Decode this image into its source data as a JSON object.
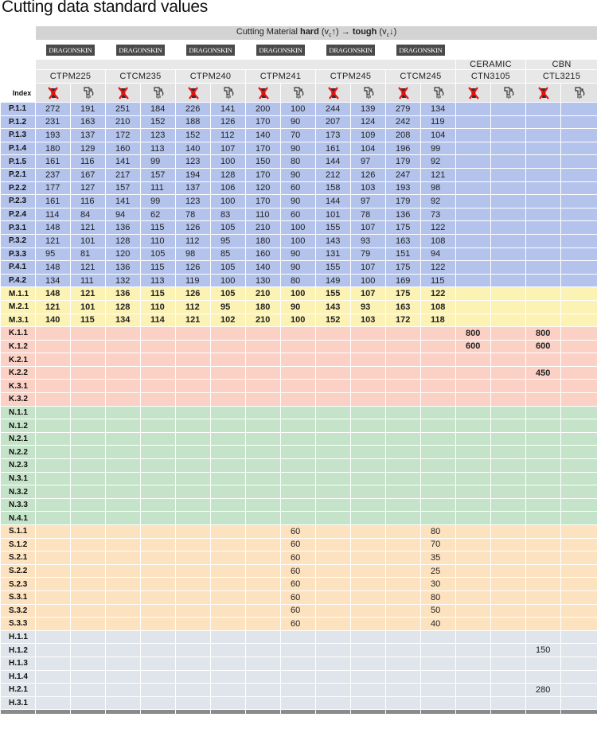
{
  "page_title": "Cutting data standard values",
  "band": {
    "pre": "Cutting Material ",
    "hard": "hard",
    "mid1": " (v",
    "sub1": "c",
    "arrow1": "↑) → ",
    "tough": "tough",
    "mid2": " (v",
    "sub2": "c",
    "arrow2": "↓)"
  },
  "logo_text": "DRAGONSKIN",
  "index_label": "Index",
  "top_grades": {
    "ceramic": "CERAMIC",
    "cbn": "CBN"
  },
  "grades": [
    "CTPM225",
    "CTCM235",
    "CTPM240",
    "CTPM241",
    "CTPM245",
    "CTCM245",
    "CTN3105",
    "CTL3215"
  ],
  "icons": {
    "dry": "dry-cutting-icon",
    "wet": "coolant-icon"
  },
  "colors": {
    "P": "#b4c3ec",
    "M": "#fbf2b4",
    "K": "#fbd1c6",
    "N": "#c5e3c9",
    "S": "#fde2bf",
    "H": "#dfe5ea"
  },
  "rows": [
    {
      "idx": "P.1.1",
      "g": "P",
      "bold": false,
      "v": [
        "272",
        "191",
        "251",
        "184",
        "226",
        "141",
        "200",
        "100",
        "244",
        "139",
        "279",
        "134",
        "",
        "",
        "",
        ""
      ]
    },
    {
      "idx": "P.1.2",
      "g": "P",
      "bold": false,
      "v": [
        "231",
        "163",
        "210",
        "152",
        "188",
        "126",
        "170",
        "90",
        "207",
        "124",
        "242",
        "119",
        "",
        "",
        "",
        ""
      ]
    },
    {
      "idx": "P.1.3",
      "g": "P",
      "bold": false,
      "v": [
        "193",
        "137",
        "172",
        "123",
        "152",
        "112",
        "140",
        "70",
        "173",
        "109",
        "208",
        "104",
        "",
        "",
        "",
        ""
      ]
    },
    {
      "idx": "P.1.4",
      "g": "P",
      "bold": false,
      "v": [
        "180",
        "129",
        "160",
        "113",
        "140",
        "107",
        "170",
        "90",
        "161",
        "104",
        "196",
        "99",
        "",
        "",
        "",
        ""
      ]
    },
    {
      "idx": "P.1.5",
      "g": "P",
      "bold": false,
      "v": [
        "161",
        "116",
        "141",
        "99",
        "123",
        "100",
        "150",
        "80",
        "144",
        "97",
        "179",
        "92",
        "",
        "",
        "",
        ""
      ]
    },
    {
      "idx": "P.2.1",
      "g": "P",
      "bold": false,
      "v": [
        "237",
        "167",
        "217",
        "157",
        "194",
        "128",
        "170",
        "90",
        "212",
        "126",
        "247",
        "121",
        "",
        "",
        "",
        ""
      ]
    },
    {
      "idx": "P.2.2",
      "g": "P",
      "bold": false,
      "v": [
        "177",
        "127",
        "157",
        "111",
        "137",
        "106",
        "120",
        "60",
        "158",
        "103",
        "193",
        "98",
        "",
        "",
        "",
        ""
      ]
    },
    {
      "idx": "P.2.3",
      "g": "P",
      "bold": false,
      "v": [
        "161",
        "116",
        "141",
        "99",
        "123",
        "100",
        "170",
        "90",
        "144",
        "97",
        "179",
        "92",
        "",
        "",
        "",
        ""
      ]
    },
    {
      "idx": "P.2.4",
      "g": "P",
      "bold": false,
      "v": [
        "114",
        "84",
        "94",
        "62",
        "78",
        "83",
        "110",
        "60",
        "101",
        "78",
        "136",
        "73",
        "",
        "",
        "",
        ""
      ]
    },
    {
      "idx": "P.3.1",
      "g": "P",
      "bold": false,
      "v": [
        "148",
        "121",
        "136",
        "115",
        "126",
        "105",
        "210",
        "100",
        "155",
        "107",
        "175",
        "122",
        "",
        "",
        "",
        ""
      ]
    },
    {
      "idx": "P.3.2",
      "g": "P",
      "bold": false,
      "v": [
        "121",
        "101",
        "128",
        "110",
        "112",
        "95",
        "180",
        "100",
        "143",
        "93",
        "163",
        "108",
        "",
        "",
        "",
        ""
      ]
    },
    {
      "idx": "P.3.3",
      "g": "P",
      "bold": false,
      "v": [
        "95",
        "81",
        "120",
        "105",
        "98",
        "85",
        "160",
        "90",
        "131",
        "79",
        "151",
        "94",
        "",
        "",
        "",
        ""
      ]
    },
    {
      "idx": "P.4.1",
      "g": "P",
      "bold": false,
      "v": [
        "148",
        "121",
        "136",
        "115",
        "126",
        "105",
        "140",
        "90",
        "155",
        "107",
        "175",
        "122",
        "",
        "",
        "",
        ""
      ]
    },
    {
      "idx": "P.4.2",
      "g": "P",
      "bold": false,
      "v": [
        "134",
        "111",
        "132",
        "113",
        "119",
        "100",
        "130",
        "80",
        "149",
        "100",
        "169",
        "115",
        "",
        "",
        "",
        ""
      ]
    },
    {
      "idx": "M.1.1",
      "g": "M",
      "bold": true,
      "v": [
        "148",
        "121",
        "136",
        "115",
        "126",
        "105",
        "210",
        "100",
        "155",
        "107",
        "175",
        "122",
        "",
        "",
        "",
        ""
      ]
    },
    {
      "idx": "M.2.1",
      "g": "M",
      "bold": true,
      "v": [
        "121",
        "101",
        "128",
        "110",
        "112",
        "95",
        "180",
        "90",
        "143",
        "93",
        "163",
        "108",
        "",
        "",
        "",
        ""
      ]
    },
    {
      "idx": "M.3.1",
      "g": "M",
      "bold": true,
      "v": [
        "140",
        "115",
        "134",
        "114",
        "121",
        "102",
        "210",
        "100",
        "152",
        "103",
        "172",
        "118",
        "",
        "",
        "",
        ""
      ]
    },
    {
      "idx": "K.1.1",
      "g": "K",
      "bold": true,
      "v": [
        "",
        "",
        "",
        "",
        "",
        "",
        "",
        "",
        "",
        "",
        "",
        "",
        "800",
        "",
        "800",
        ""
      ]
    },
    {
      "idx": "K.1.2",
      "g": "K",
      "bold": true,
      "v": [
        "",
        "",
        "",
        "",
        "",
        "",
        "",
        "",
        "",
        "",
        "",
        "",
        "600",
        "",
        "600",
        ""
      ]
    },
    {
      "idx": "K.2.1",
      "g": "K",
      "bold": true,
      "v": [
        "",
        "",
        "",
        "",
        "",
        "",
        "",
        "",
        "",
        "",
        "",
        "",
        "",
        "",
        "",
        ""
      ]
    },
    {
      "idx": "K.2.2",
      "g": "K",
      "bold": true,
      "v": [
        "",
        "",
        "",
        "",
        "",
        "",
        "",
        "",
        "",
        "",
        "",
        "",
        "",
        "",
        "450",
        ""
      ]
    },
    {
      "idx": "K.3.1",
      "g": "K",
      "bold": true,
      "v": [
        "",
        "",
        "",
        "",
        "",
        "",
        "",
        "",
        "",
        "",
        "",
        "",
        "",
        "",
        "",
        ""
      ]
    },
    {
      "idx": "K.3.2",
      "g": "K",
      "bold": true,
      "v": [
        "",
        "",
        "",
        "",
        "",
        "",
        "",
        "",
        "",
        "",
        "",
        "",
        "",
        "",
        "",
        ""
      ]
    },
    {
      "idx": "N.1.1",
      "g": "N",
      "bold": false,
      "v": [
        "",
        "",
        "",
        "",
        "",
        "",
        "",
        "",
        "",
        "",
        "",
        "",
        "",
        "",
        "",
        ""
      ]
    },
    {
      "idx": "N.1.2",
      "g": "N",
      "bold": false,
      "v": [
        "",
        "",
        "",
        "",
        "",
        "",
        "",
        "",
        "",
        "",
        "",
        "",
        "",
        "",
        "",
        ""
      ]
    },
    {
      "idx": "N.2.1",
      "g": "N",
      "bold": false,
      "v": [
        "",
        "",
        "",
        "",
        "",
        "",
        "",
        "",
        "",
        "",
        "",
        "",
        "",
        "",
        "",
        ""
      ]
    },
    {
      "idx": "N.2.2",
      "g": "N",
      "bold": false,
      "v": [
        "",
        "",
        "",
        "",
        "",
        "",
        "",
        "",
        "",
        "",
        "",
        "",
        "",
        "",
        "",
        ""
      ]
    },
    {
      "idx": "N.2.3",
      "g": "N",
      "bold": false,
      "v": [
        "",
        "",
        "",
        "",
        "",
        "",
        "",
        "",
        "",
        "",
        "",
        "",
        "",
        "",
        "",
        ""
      ]
    },
    {
      "idx": "N.3.1",
      "g": "N",
      "bold": false,
      "v": [
        "",
        "",
        "",
        "",
        "",
        "",
        "",
        "",
        "",
        "",
        "",
        "",
        "",
        "",
        "",
        ""
      ]
    },
    {
      "idx": "N.3.2",
      "g": "N",
      "bold": false,
      "v": [
        "",
        "",
        "",
        "",
        "",
        "",
        "",
        "",
        "",
        "",
        "",
        "",
        "",
        "",
        "",
        ""
      ]
    },
    {
      "idx": "N.3.3",
      "g": "N",
      "bold": false,
      "v": [
        "",
        "",
        "",
        "",
        "",
        "",
        "",
        "",
        "",
        "",
        "",
        "",
        "",
        "",
        "",
        ""
      ]
    },
    {
      "idx": "N.4.1",
      "g": "N",
      "bold": false,
      "v": [
        "",
        "",
        "",
        "",
        "",
        "",
        "",
        "",
        "",
        "",
        "",
        "",
        "",
        "",
        "",
        ""
      ]
    },
    {
      "idx": "S.1.1",
      "g": "S",
      "bold": false,
      "v": [
        "",
        "",
        "",
        "",
        "",
        "",
        "",
        "60",
        "",
        "",
        "",
        "80",
        "",
        "",
        "",
        ""
      ]
    },
    {
      "idx": "S.1.2",
      "g": "S",
      "bold": false,
      "v": [
        "",
        "",
        "",
        "",
        "",
        "",
        "",
        "60",
        "",
        "",
        "",
        "70",
        "",
        "",
        "",
        ""
      ]
    },
    {
      "idx": "S.2.1",
      "g": "S",
      "bold": false,
      "v": [
        "",
        "",
        "",
        "",
        "",
        "",
        "",
        "60",
        "",
        "",
        "",
        "35",
        "",
        "",
        "",
        ""
      ]
    },
    {
      "idx": "S.2.2",
      "g": "S",
      "bold": false,
      "v": [
        "",
        "",
        "",
        "",
        "",
        "",
        "",
        "60",
        "",
        "",
        "",
        "25",
        "",
        "",
        "",
        ""
      ]
    },
    {
      "idx": "S.2.3",
      "g": "S",
      "bold": false,
      "v": [
        "",
        "",
        "",
        "",
        "",
        "",
        "",
        "60",
        "",
        "",
        "",
        "30",
        "",
        "",
        "",
        ""
      ]
    },
    {
      "idx": "S.3.1",
      "g": "S",
      "bold": false,
      "v": [
        "",
        "",
        "",
        "",
        "",
        "",
        "",
        "60",
        "",
        "",
        "",
        "80",
        "",
        "",
        "",
        ""
      ]
    },
    {
      "idx": "S.3.2",
      "g": "S",
      "bold": false,
      "v": [
        "",
        "",
        "",
        "",
        "",
        "",
        "",
        "60",
        "",
        "",
        "",
        "50",
        "",
        "",
        "",
        ""
      ]
    },
    {
      "idx": "S.3.3",
      "g": "S",
      "bold": false,
      "v": [
        "",
        "",
        "",
        "",
        "",
        "",
        "",
        "60",
        "",
        "",
        "",
        "40",
        "",
        "",
        "",
        ""
      ]
    },
    {
      "idx": "H.1.1",
      "g": "H",
      "bold": false,
      "v": [
        "",
        "",
        "",
        "",
        "",
        "",
        "",
        "",
        "",
        "",
        "",
        "",
        "",
        "",
        "",
        ""
      ]
    },
    {
      "idx": "H.1.2",
      "g": "H",
      "bold": false,
      "v": [
        "",
        "",
        "",
        "",
        "",
        "",
        "",
        "",
        "",
        "",
        "",
        "",
        "",
        "",
        "150",
        ""
      ]
    },
    {
      "idx": "H.1.3",
      "g": "H",
      "bold": false,
      "v": [
        "",
        "",
        "",
        "",
        "",
        "",
        "",
        "",
        "",
        "",
        "",
        "",
        "",
        "",
        "",
        ""
      ]
    },
    {
      "idx": "H.1.4",
      "g": "H",
      "bold": false,
      "v": [
        "",
        "",
        "",
        "",
        "",
        "",
        "",
        "",
        "",
        "",
        "",
        "",
        "",
        "",
        "",
        ""
      ]
    },
    {
      "idx": "H.2.1",
      "g": "H",
      "bold": false,
      "v": [
        "",
        "",
        "",
        "",
        "",
        "",
        "",
        "",
        "",
        "",
        "",
        "",
        "",
        "",
        "280",
        ""
      ]
    },
    {
      "idx": "H.3.1",
      "g": "H",
      "bold": false,
      "v": [
        "",
        "",
        "",
        "",
        "",
        "",
        "",
        "",
        "",
        "",
        "",
        "",
        "",
        "",
        "",
        ""
      ]
    }
  ]
}
